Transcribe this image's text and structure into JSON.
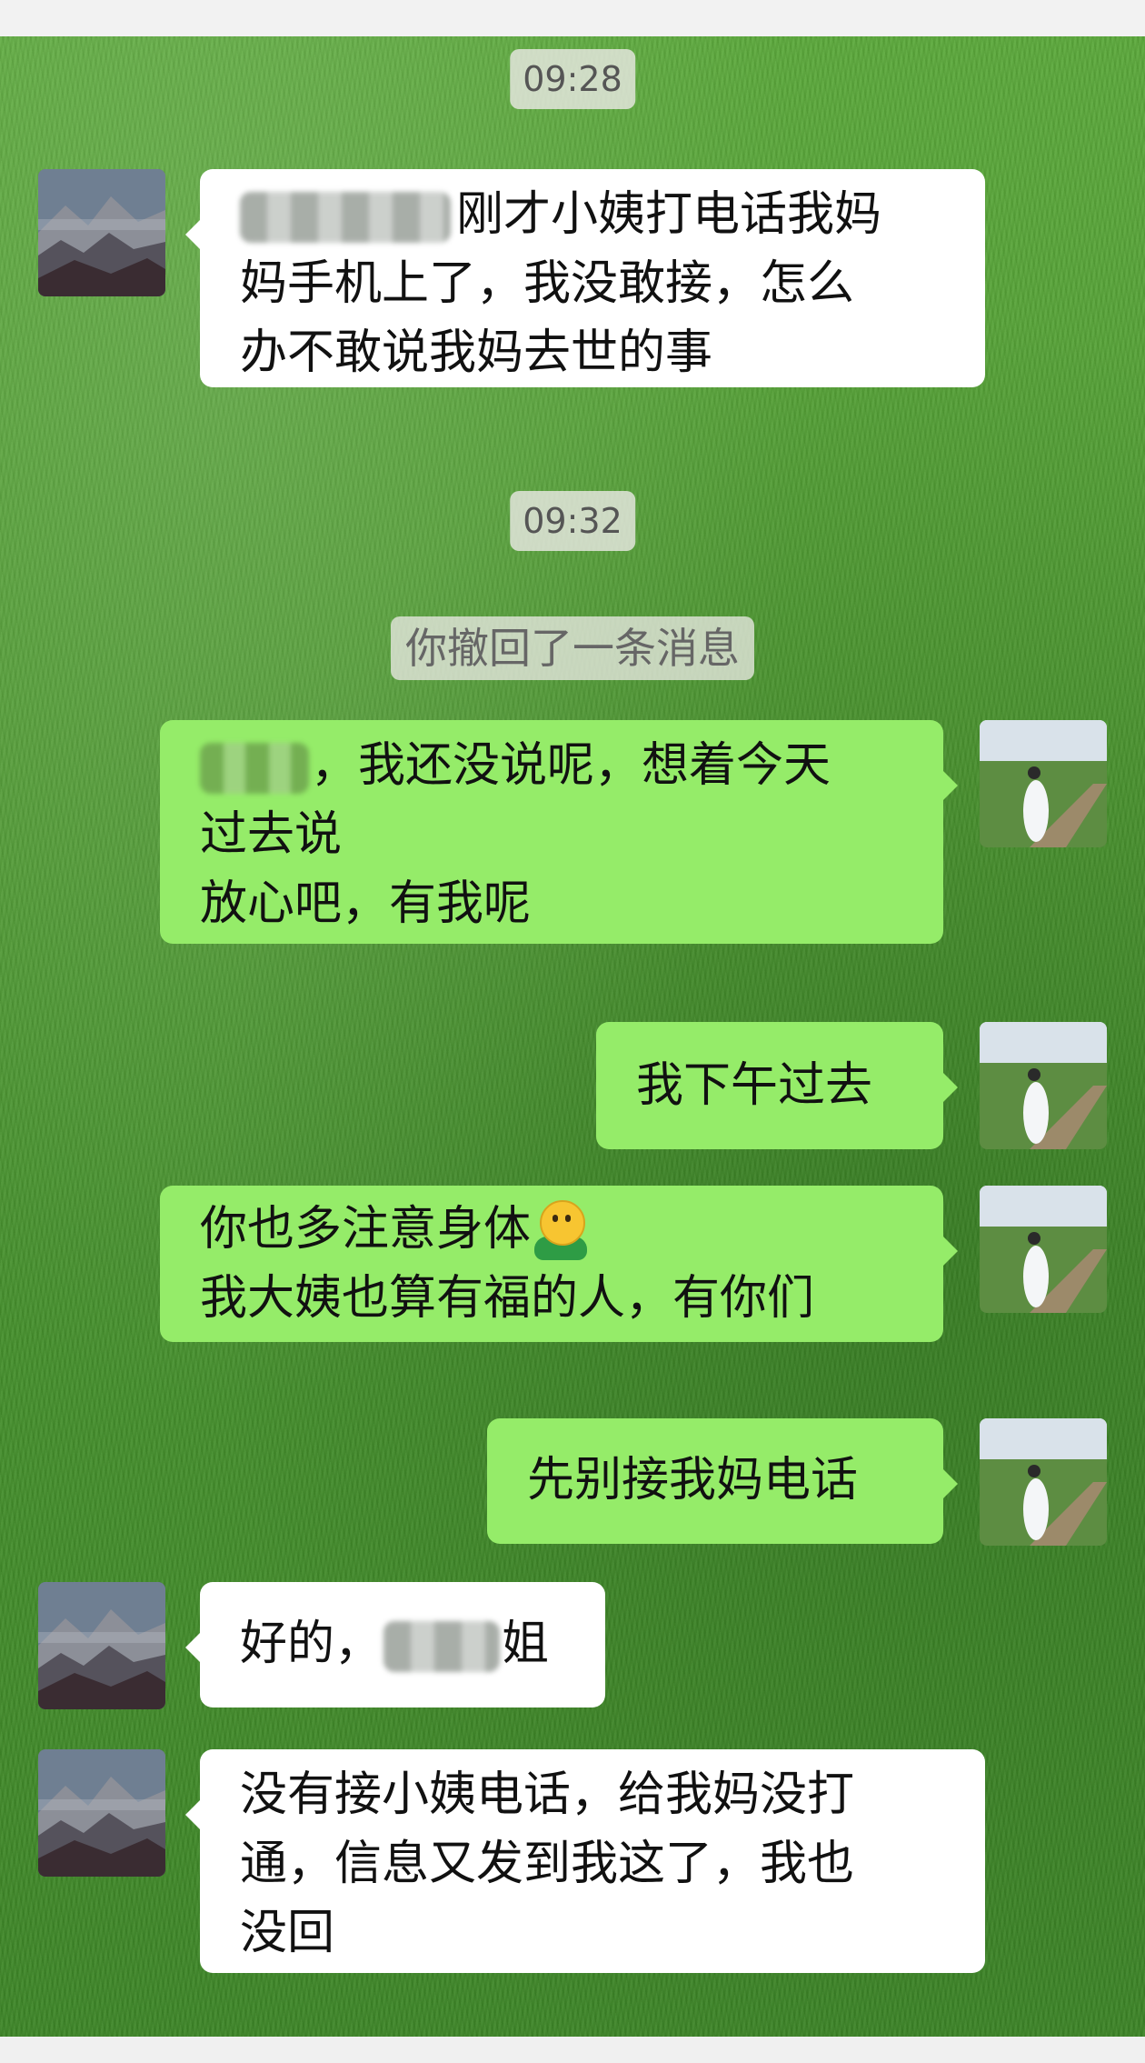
{
  "chat": {
    "timestamps": [
      "09:28",
      "09:32"
    ],
    "recall_notice": "你撤回了一条消息",
    "messages": [
      {
        "side": "in",
        "lines": [
          "刚才小姨打电话我妈",
          "妈手机上了，我没敢接，怎么",
          "办不敢说我妈去世的事"
        ]
      },
      {
        "side": "out",
        "lines": [
          "，我还没说呢，想着今天",
          "过去说",
          "放心吧，有我呢"
        ]
      },
      {
        "side": "out",
        "lines": [
          "我下午过去"
        ]
      },
      {
        "side": "out",
        "lines": [
          "你也多注意身体",
          "我大姨也算有福的人，有你们"
        ]
      },
      {
        "side": "out",
        "lines": [
          "先别接我妈电话"
        ]
      },
      {
        "side": "in",
        "lines": [
          "好的，",
          "姐"
        ]
      },
      {
        "side": "in",
        "lines": [
          "没有接小姨电话，给我妈没打",
          "通，信息又发到我这了，我也",
          "没回"
        ]
      }
    ]
  },
  "icons": {
    "contact_avatar": "mountain-landscape-avatar",
    "self_avatar": "woman-on-boardwalk-avatar",
    "emoji": "green-shirt-smiley-emoji"
  },
  "colors": {
    "incoming_bubble": "#ffffff",
    "outgoing_bubble": "#95ec69",
    "chat_background": "#4f9a32"
  }
}
